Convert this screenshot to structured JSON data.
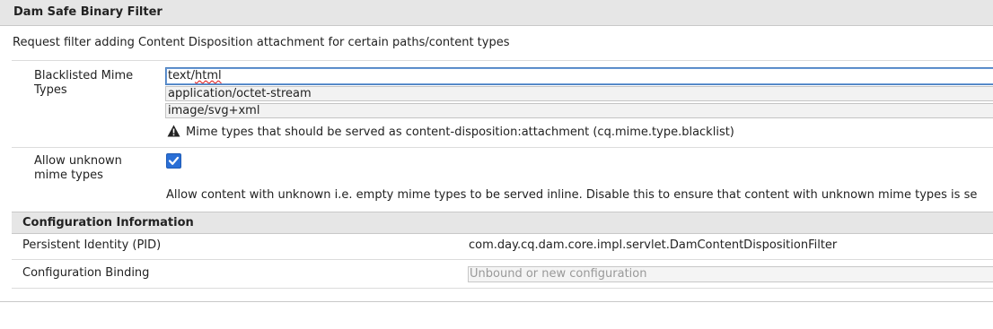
{
  "panel": {
    "title": "Dam Safe Binary Filter",
    "description": "Request filter adding Content Disposition attachment for certain paths/content types"
  },
  "blacklisted_mime_types": {
    "label": "Blacklisted Mime Types",
    "values": [
      "text/html",
      "application/octet-stream",
      "image/svg+xml"
    ],
    "hint_icon": "warning-icon",
    "hint": "Mime types that should be served as content-disposition:attachment (cq.mime.type.blacklist)"
  },
  "allow_unknown": {
    "label": "Allow unknown mime types",
    "checked": true,
    "description": "Allow content with unknown i.e. empty mime types to be served inline. Disable this to ensure that content with unknown mime types is se"
  },
  "configuration_information": {
    "title": "Configuration Information",
    "pid_label": "Persistent Identity (PID)",
    "pid_value": "com.day.cq.dam.core.impl.servlet.DamContentDispositionFilter",
    "binding_label": "Configuration Binding",
    "binding_placeholder": "Unbound or new configuration"
  },
  "colors": {
    "header_bg": "#e6e6e6",
    "checkbox": "#2a6fd6",
    "focus_border": "#4a7fbf"
  }
}
